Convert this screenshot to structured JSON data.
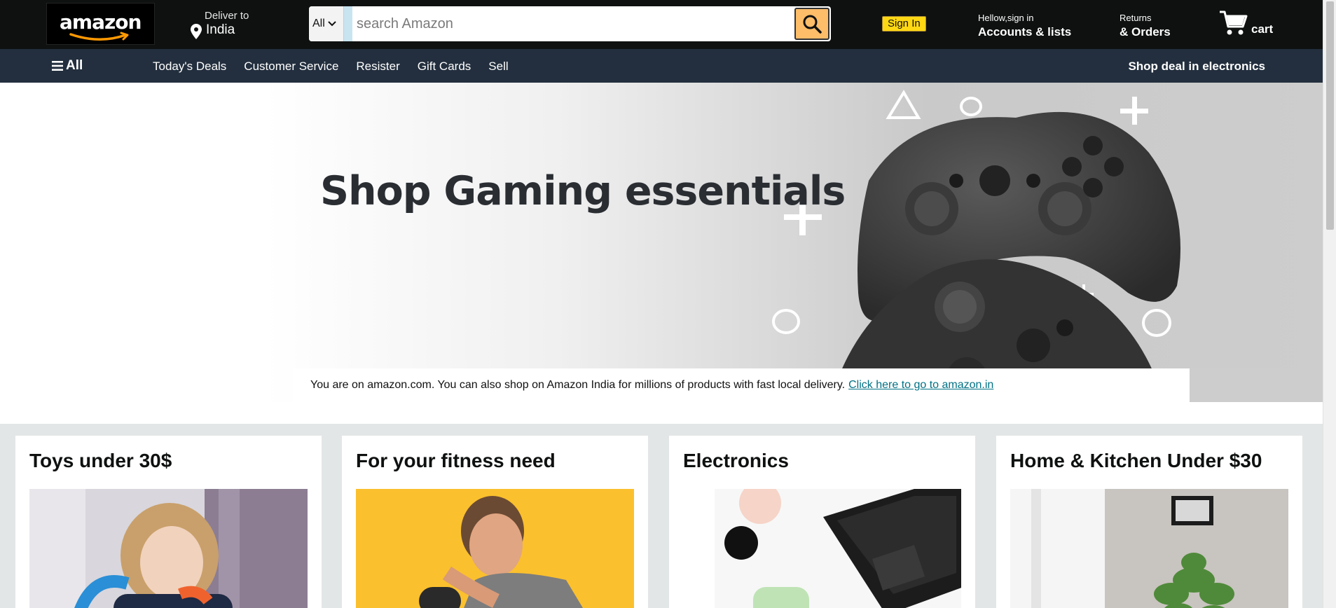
{
  "header": {
    "logo_text": "amazon",
    "deliver_label": "Deliver to",
    "deliver_location": "India",
    "search": {
      "category": "All",
      "placeholder": "search Amazon"
    },
    "sign_in_button": "Sign In",
    "account_line1": "Hellow,sign in",
    "account_line2": "Accounts & lists",
    "returns_line1": "Returns",
    "returns_line2": "& Orders",
    "cart_label": "cart"
  },
  "subnav": {
    "all_label": "All",
    "links": [
      "Today's Deals",
      "Customer Service",
      "Resister",
      "Gift Cards",
      "Sell"
    ],
    "promo": "Shop deal in electronics"
  },
  "hero": {
    "title": "Shop Gaming essentials",
    "notice_text": "You are on amazon.com. You can also shop on Amazon India for millions of products with fast local delivery.",
    "notice_link": "Click here to go to amazon.in"
  },
  "cards": [
    {
      "title": "Toys under 30$",
      "image": "child-playing-with-toys"
    },
    {
      "title": "For your fitness need",
      "image": "man-exercising"
    },
    {
      "title": "Electronics",
      "image": "laptop-on-desk"
    },
    {
      "title": "Home & Kitchen Under $30",
      "image": "potted-plant"
    }
  ],
  "colors": {
    "nav_top": "#0f1111",
    "nav_sub": "#232f3e",
    "search_button": "#febd69",
    "sign_in": "#ffd814",
    "link": "#007185",
    "page_bg": "#e3e6e6"
  }
}
